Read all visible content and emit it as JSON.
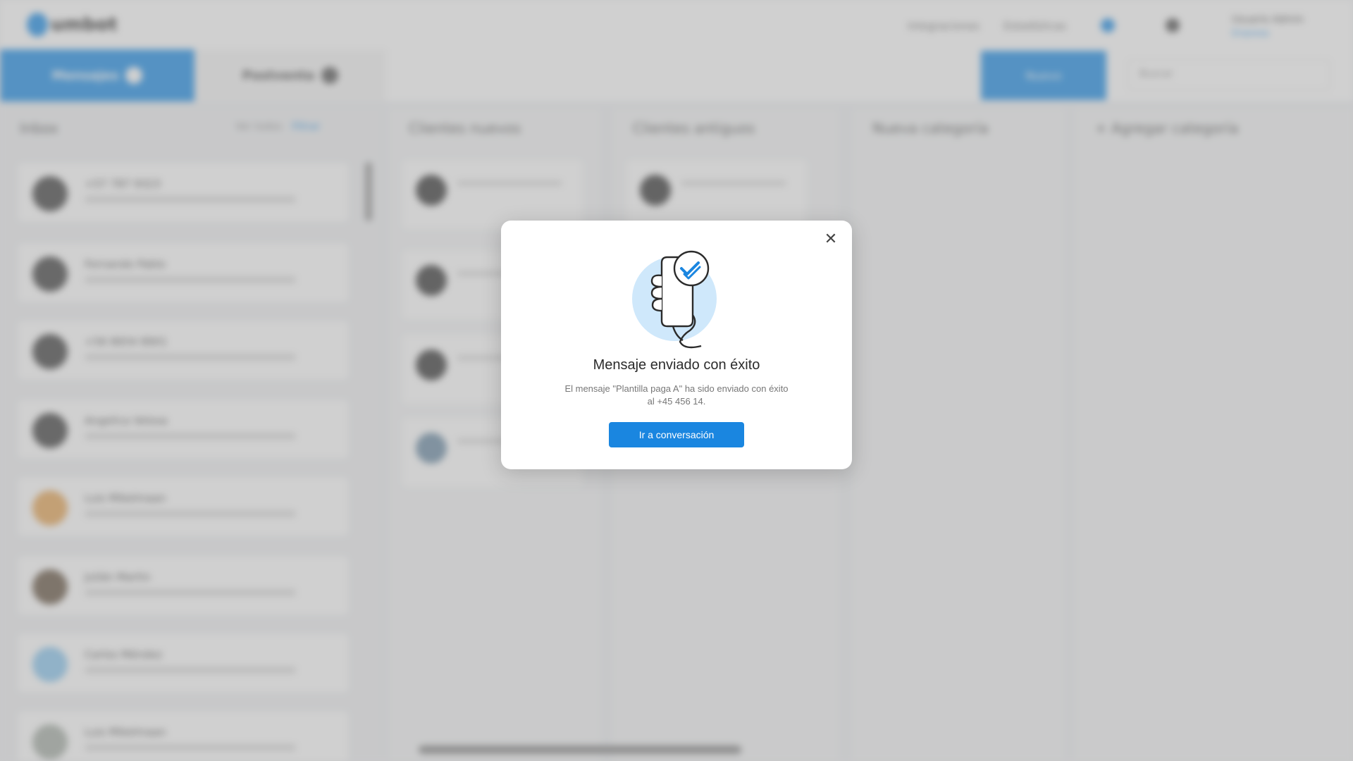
{
  "app": {
    "logo_text": "umbot",
    "top_links": [
      "Integraciones",
      "Estadísticas"
    ],
    "user_name": "Usuario Admin",
    "user_sub": "Empresa",
    "tabs": {
      "messages": "Mensajes",
      "posts": "Postventa"
    },
    "new_button": "Nuevo",
    "search_placeholder": "Buscar",
    "inbox": {
      "title": "Inbox",
      "filter_all": "Ver todos",
      "filter_sort": "Filtrar"
    },
    "contacts": [
      "+57 787 9323",
      "Fernando Pablo",
      "+56 8654 8901",
      "Angelica Velosa",
      "Luis Mikelmaan",
      "Julián Martin",
      "Carlos Méndez",
      "Luis Mikelmaan"
    ],
    "columns": [
      "Clientes nuevos",
      "Clientes antiguos",
      "Nueva categoría",
      "+  Agregar categoría"
    ]
  },
  "modal": {
    "title": "Mensaje enviado con éxito",
    "body": "El mensaje \"Plantilla paga A\" ha sido enviado con éxito al +45 456 14.",
    "button": "Ir a conversación",
    "close": "✕"
  },
  "colors": {
    "accent": "#1a86e0",
    "illustration_circle": "#cfe8fb"
  }
}
